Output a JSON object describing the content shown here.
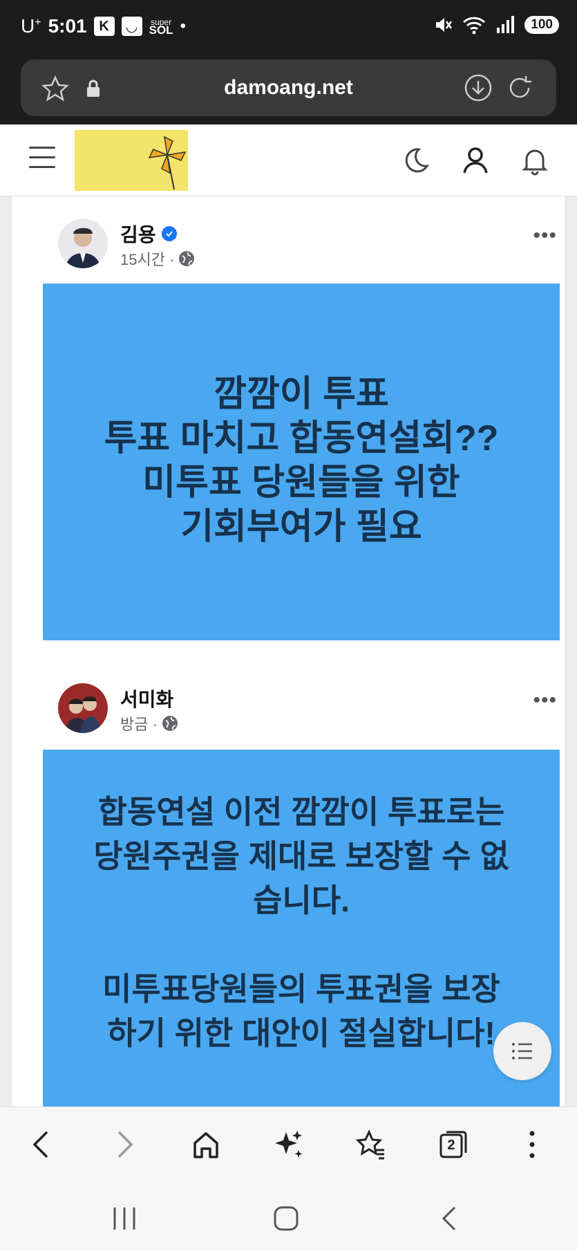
{
  "status_bar": {
    "carrier": "U",
    "carrier_sup": "+",
    "time": "5:01",
    "app_badge_1": "K",
    "app_badge_2": "◡",
    "super_label": "super",
    "sol_label": "SOL",
    "dot": "•",
    "battery": "100"
  },
  "browser": {
    "url": "damoang.net",
    "tab_count": "2"
  },
  "posts": [
    {
      "author": "김용",
      "verified": true,
      "meta": "15시간 ·",
      "more": "•••",
      "lines": [
        "깜깜이 투표",
        "투표 마치고 합동연설회??",
        "미투표 당원들을 위한",
        "기회부여가 필요"
      ]
    },
    {
      "author": "서미화",
      "verified": false,
      "meta": "방금 ·",
      "more": "•••",
      "lines": [
        "합동연설 이전 깜깜이 투표로는",
        "당원주권을 제대로 보장할 수 없",
        "습니다.",
        "",
        "미투표당원들의 투표권을 보장",
        "하기 위한 대안이 절실합니다!"
      ]
    }
  ],
  "colors": {
    "panel_blue": "#4aa8f0",
    "panel_text": "#17324d",
    "logo_yellow": "#f3e46a"
  }
}
